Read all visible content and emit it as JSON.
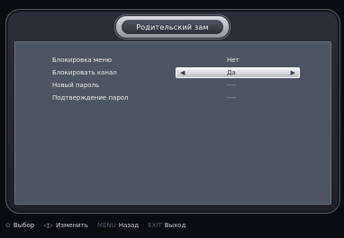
{
  "title": "Родительский зам",
  "menu": {
    "rows": [
      {
        "label": "Блокировка меню",
        "value": "Нет"
      },
      {
        "label": "Блокировать канал",
        "value": "Да"
      },
      {
        "label": "Новый пароль",
        "value": "----"
      },
      {
        "label": "Подтверждение парол",
        "value": "----"
      }
    ]
  },
  "footer": {
    "select_key": "⊙",
    "select_label": "Выбор",
    "change_key": "◁▷",
    "change_label": "Изменить",
    "menu_key": "MENU",
    "menu_label": "Назад",
    "exit_key": "EXIT",
    "exit_label": "Выход"
  },
  "colors": {
    "panel": "#4d5564",
    "frame": "#2c2e38",
    "highlight": "#e6e8ec"
  },
  "icons": {
    "left_arrow": "arrow-left-icon",
    "right_arrow": "arrow-right-icon"
  }
}
